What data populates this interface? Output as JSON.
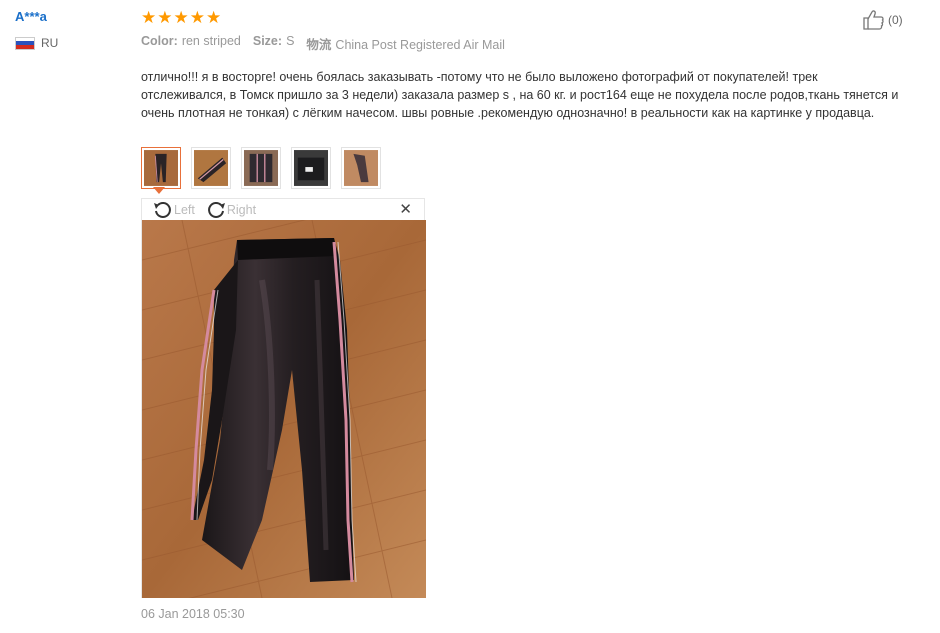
{
  "buyer": {
    "name": "A***a",
    "country": "RU",
    "flag_colors": [
      "#ffffff",
      "#2a52be",
      "#d52b1e"
    ]
  },
  "review": {
    "rating": 5,
    "star_glyph": "★",
    "star_color": "#ff9900",
    "color_label": "Color:",
    "color_value": "ren striped",
    "size_label": "Size:",
    "size_value": "S",
    "shipping_label": "物流",
    "shipping_value": "China Post Registered Air Mail",
    "helpful_count": "(0)",
    "helpful_icon": "thumbs-up-icon",
    "text": "отлично!!! я в восторге! очень боялась заказывать -потому что не было выложено фотографий от покупателей! трек отслеживался, в Томск пришло за 3 недели) заказала размер s , на 60 кг. и рост164 еще не похудела после родов,ткань тянется и очень плотная не тонкая) с лёгким начесом. швы ровные .рекомендую однозначно! в реальности как на картинке у продавца.",
    "date": "06 Jan 2018 05:30"
  },
  "viewer": {
    "rotate_left_label": "Left",
    "rotate_right_label": "Right",
    "close_glyph": "✕",
    "rotate_left_icon": "rotate-left-icon",
    "rotate_right_icon": "rotate-right-icon"
  },
  "thumbnails": [
    "photo-1",
    "photo-2",
    "photo-3",
    "photo-4",
    "photo-5"
  ],
  "accent_color": "#e8703a"
}
